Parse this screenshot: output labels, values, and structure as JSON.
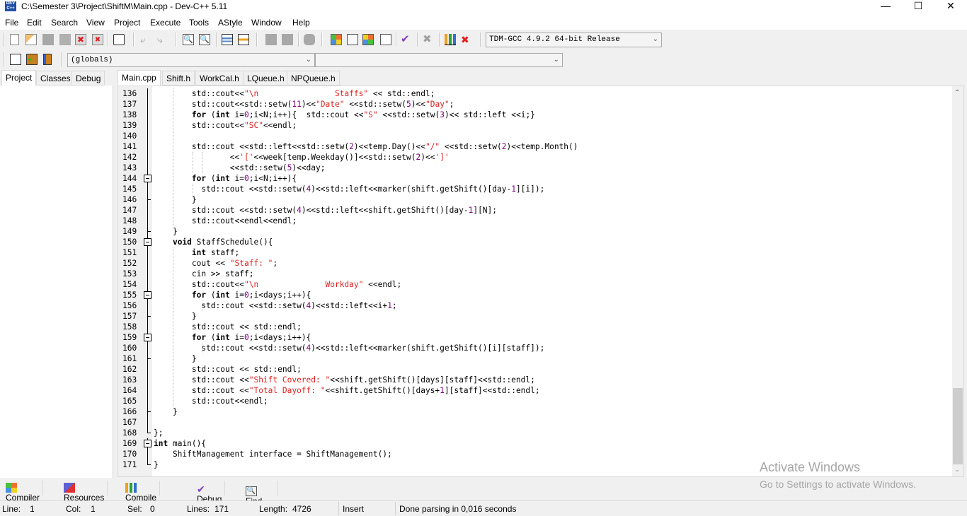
{
  "window": {
    "title": "C:\\Semester 3\\Project\\ShiftM\\Main.cpp - Dev-C++ 5.11",
    "icon": "devcpp-app-icon",
    "controls": [
      "minimize",
      "maximize",
      "close"
    ]
  },
  "menu": [
    "File",
    "Edit",
    "Search",
    "View",
    "Project",
    "Execute",
    "Tools",
    "AStyle",
    "Window",
    "Help"
  ],
  "toolbar": {
    "compiler_select": "TDM-GCC 4.9.2 64-bit Release",
    "scope_select": "(globals)",
    "member_select": "",
    "icons": [
      "new-file",
      "open-file",
      "save",
      "save-all",
      "close",
      "close-all",
      "print",
      "undo",
      "redo",
      "find",
      "replace",
      "indent",
      "unindent",
      "toggle-bookmark",
      "goto-bookmark",
      "goto-line",
      "compile",
      "run",
      "compile-run",
      "rebuild-all",
      "syntax-check",
      "abort",
      "profile",
      "delete-profile",
      "new-class",
      "add-to-project",
      "remove-from-project"
    ]
  },
  "left_tabs": [
    "Project",
    "Classes",
    "Debug"
  ],
  "editor_tabs": [
    "Main.cpp",
    "Shift.h",
    "WorkCal.h",
    "LQueue.h",
    "NPQueue.h"
  ],
  "code_lines": [
    {
      "n": "136",
      "text": "        std::cout<<\"\\n                Staffs\" << std::endl;"
    },
    {
      "n": "137",
      "text": "        std::cout<<std::setw(11)<<\"Date\" <<std::setw(5)<<\"Day\";"
    },
    {
      "n": "138",
      "text": "        for (int i=0;i<N;i++){  std::cout <<\"S\" <<std::setw(3)<< std::left <<i;}"
    },
    {
      "n": "139",
      "text": "        std::cout<<\"SC\"<<endl;"
    },
    {
      "n": "140",
      "text": ""
    },
    {
      "n": "141",
      "text": "        std::cout <<std::left<<std::setw(2)<<temp.Day()<<\"/\" <<std::setw(2)<<temp.Month()"
    },
    {
      "n": "142",
      "text": "                <<'['<<week[temp.Weekday()]<<std::setw(2)<<']'"
    },
    {
      "n": "143",
      "text": "                <<std::setw(5)<<day;"
    },
    {
      "n": "144",
      "text": "        for (int i=0;i<N;i++){"
    },
    {
      "n": "145",
      "text": "          std::cout <<std::setw(4)<<std::left<<marker(shift.getShift()[day-1][i]);"
    },
    {
      "n": "146",
      "text": "        }"
    },
    {
      "n": "147",
      "text": "        std::cout <<std::setw(4)<<std::left<<shift.getShift()[day-1][N];"
    },
    {
      "n": "148",
      "text": "        std::cout<<endl<<endl;"
    },
    {
      "n": "149",
      "text": "    }"
    },
    {
      "n": "150",
      "text": "    void StaffSchedule(){"
    },
    {
      "n": "151",
      "text": "        int staff;"
    },
    {
      "n": "152",
      "text": "        cout << \"Staff: \";"
    },
    {
      "n": "153",
      "text": "        cin >> staff;"
    },
    {
      "n": "154",
      "text": "        std::cout<<\"\\n              Workday\" <<endl;"
    },
    {
      "n": "155",
      "text": "        for (int i=0;i<days;i++){"
    },
    {
      "n": "156",
      "text": "          std::cout <<std::setw(4)<<std::left<<i+1;"
    },
    {
      "n": "157",
      "text": "        }"
    },
    {
      "n": "158",
      "text": "        std::cout << std::endl;"
    },
    {
      "n": "159",
      "text": "        for (int i=0;i<days;i++){"
    },
    {
      "n": "160",
      "text": "          std::cout <<std::setw(4)<<std::left<<marker(shift.getShift()[i][staff]);"
    },
    {
      "n": "161",
      "text": "        }"
    },
    {
      "n": "162",
      "text": "        std::cout << std::endl;"
    },
    {
      "n": "163",
      "text": "        std::cout <<\"Shift Covered: \"<<shift.getShift()[days][staff]<<std::endl;"
    },
    {
      "n": "164",
      "text": "        std::cout <<\"Total Dayoff: \"<<shift.getShift()[days+1][staff]<<std::endl;"
    },
    {
      "n": "165",
      "text": "        std::cout<<endl;"
    },
    {
      "n": "166",
      "text": "    }"
    },
    {
      "n": "167",
      "text": ""
    },
    {
      "n": "168",
      "text": "};"
    },
    {
      "n": "169",
      "text": "int main(){"
    },
    {
      "n": "170",
      "text": "    ShiftManagement interface = ShiftManagement();"
    },
    {
      "n": "171",
      "text": "}"
    }
  ],
  "bottom_tabs": [
    "Compiler",
    "Resources",
    "Compile Log",
    "Debug",
    "Find Results"
  ],
  "status": {
    "line_label": "Line:",
    "line": "1",
    "col_label": "Col:",
    "col": "1",
    "sel_label": "Sel:",
    "sel": "0",
    "lines_label": "Lines:",
    "lines": "171",
    "length_label": "Length:",
    "length": "4726",
    "mode": "Insert",
    "message": "Done parsing in 0,016 seconds"
  },
  "watermark": {
    "title": "Activate Windows",
    "subtitle": "Go to Settings to activate Windows."
  },
  "colors": {
    "string": "#e02020",
    "number": "#800080",
    "gutter": "#f0f0f0"
  }
}
